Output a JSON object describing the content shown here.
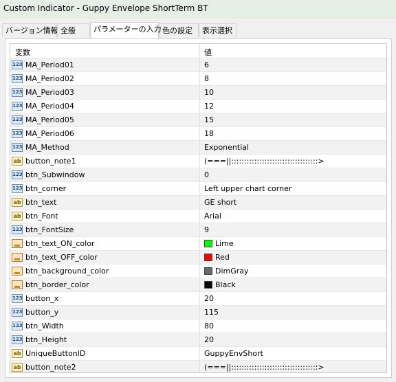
{
  "window": {
    "title": "Custom Indicator - Guppy Envelope ShortTerm BT"
  },
  "tabs": [
    {
      "label": "バージョン情報",
      "active": false
    },
    {
      "label": "全般",
      "active": false
    },
    {
      "label": "パラメーターの入力",
      "active": true
    },
    {
      "label": "色の設定",
      "active": false
    },
    {
      "label": "表示選択",
      "active": false
    }
  ],
  "grid": {
    "header": {
      "variable": "変数",
      "value": "値"
    },
    "rows": [
      {
        "name": "MA_Period01",
        "value": "6",
        "icon": "numeric-icon"
      },
      {
        "name": "MA_Period02",
        "value": "8",
        "icon": "numeric-icon"
      },
      {
        "name": "MA_Period03",
        "value": "10",
        "icon": "numeric-icon"
      },
      {
        "name": "MA_Period04",
        "value": "12",
        "icon": "numeric-icon"
      },
      {
        "name": "MA_Period05",
        "value": "15",
        "icon": "numeric-icon"
      },
      {
        "name": "MA_Period06",
        "value": "18",
        "icon": "numeric-icon"
      },
      {
        "name": "MA_Method",
        "value": "Exponential",
        "icon": "numeric-icon"
      },
      {
        "name": "button_note1",
        "value": "(===||::::::::::::::::::::::::::::::::::>",
        "icon": "string-icon"
      },
      {
        "name": "btn_Subwindow",
        "value": "0",
        "icon": "numeric-icon"
      },
      {
        "name": "btn_corner",
        "value": "Left upper chart corner",
        "icon": "numeric-icon"
      },
      {
        "name": "btn_text",
        "value": "GE short",
        "icon": "string-icon"
      },
      {
        "name": "btn_Font",
        "value": "Arial",
        "icon": "string-icon"
      },
      {
        "name": "btn_FontSize",
        "value": "9",
        "icon": "numeric-icon"
      },
      {
        "name": "btn_text_ON_color",
        "value": "Lime",
        "icon": "color-icon",
        "swatch": "#00ff00"
      },
      {
        "name": "btn_text_OFF_color",
        "value": "Red",
        "icon": "color-icon",
        "swatch": "#ff0000"
      },
      {
        "name": "btn_background_color",
        "value": "DimGray",
        "icon": "color-icon",
        "swatch": "#696969"
      },
      {
        "name": "btn_border_color",
        "value": "Black",
        "icon": "color-icon",
        "swatch": "#000000"
      },
      {
        "name": "button_x",
        "value": "20",
        "icon": "numeric-icon"
      },
      {
        "name": "button_y",
        "value": "115",
        "icon": "numeric-icon"
      },
      {
        "name": "btn_Width",
        "value": "80",
        "icon": "numeric-icon"
      },
      {
        "name": "btn_Height",
        "value": "20",
        "icon": "numeric-icon"
      },
      {
        "name": "UniqueButtonID",
        "value": "GuppyEnvShort",
        "icon": "string-icon"
      },
      {
        "name": "button_note2",
        "value": "(===||::::::::::::::::::::::::::::::::::>",
        "icon": "string-icon"
      }
    ]
  }
}
